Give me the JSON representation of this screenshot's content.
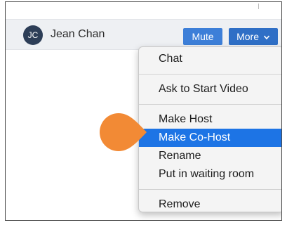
{
  "participant": {
    "initials": "JC",
    "name": "Jean Chan"
  },
  "buttons": {
    "mute_label": "Mute",
    "more_label": "More"
  },
  "menu": {
    "items": [
      {
        "label": "Chat"
      },
      {
        "label": "Ask to Start Video"
      },
      {
        "label": "Make Host"
      },
      {
        "label": "Make Co-Host"
      },
      {
        "label": "Rename"
      },
      {
        "label": "Put in waiting room"
      },
      {
        "label": "Remove"
      }
    ],
    "highlighted_item": "Make Co-Host"
  },
  "icons": {
    "more_chevron": "chevron-down-icon",
    "callout_pointer": "pointer-callout-icon"
  },
  "colors": {
    "button_blue": "#3d7fd8",
    "highlight_blue": "#1d74e5",
    "avatar_bg": "#2d3e57",
    "callout_orange": "#f28a35"
  }
}
